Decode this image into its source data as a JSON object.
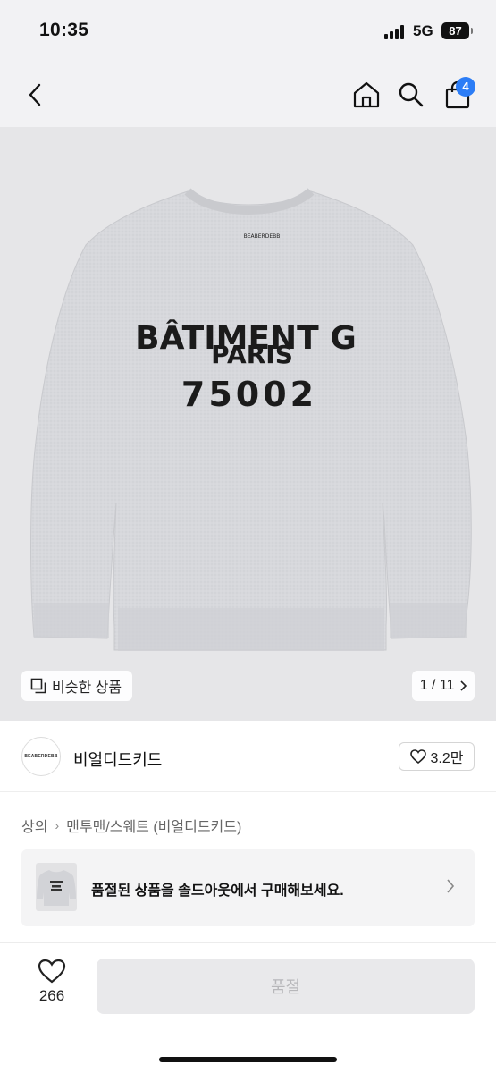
{
  "status_bar": {
    "time": "10:35",
    "network": "5G",
    "battery": "87"
  },
  "header": {
    "back_icon": "chevron-left-icon",
    "home_icon": "home-icon",
    "search_icon": "search-icon",
    "cart_icon": "shopping-bag-icon",
    "cart_count": "4",
    "accent_color": "#2c7df6"
  },
  "product_image": {
    "print_lines": [
      "BÂTIMENT G",
      "PARIS",
      "75002"
    ],
    "neck_label": "BEABERDEBB",
    "similar_label": "비슷한 상품",
    "page_indicator": "1 / 11"
  },
  "brand": {
    "logo_text": "BEABERDEBB",
    "name": "비얼디드키드",
    "like_count": "3.2만"
  },
  "breadcrumb": {
    "category": "상의",
    "subcategory": "맨투맨/스웨트 (비얼디드키드)"
  },
  "soldout_banner": {
    "message": "품절된 상품을 솔드아웃에서 구매해보세요."
  },
  "bottom_bar": {
    "like_count": "266",
    "buy_label": "품절"
  }
}
